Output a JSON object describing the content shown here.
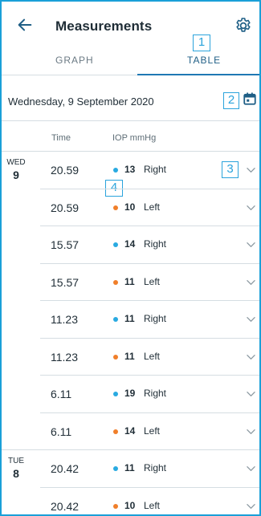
{
  "header": {
    "title": "Measurements"
  },
  "tabs": [
    {
      "label": "GRAPH",
      "active": false
    },
    {
      "label": "TABLE",
      "active": true
    }
  ],
  "callouts": [
    "1",
    "2",
    "3",
    "4"
  ],
  "date_selector": {
    "label": "Wednesday, 9 September 2020"
  },
  "columns": {
    "time": "Time",
    "iop": "IOP mmHg"
  },
  "colors": {
    "right_eye": "#29aae1",
    "left_eye": "#f07f2a",
    "accent": "#1f78b4"
  },
  "rows": [
    {
      "day_name": "WED",
      "day_num": "9",
      "time": "20.59",
      "value": "13",
      "eye": "Right",
      "eye_key": "right_eye"
    },
    {
      "day_name": "",
      "day_num": "",
      "time": "20.59",
      "value": "10",
      "eye": "Left",
      "eye_key": "left_eye"
    },
    {
      "day_name": "",
      "day_num": "",
      "time": "15.57",
      "value": "14",
      "eye": "Right",
      "eye_key": "right_eye"
    },
    {
      "day_name": "",
      "day_num": "",
      "time": "15.57",
      "value": "11",
      "eye": "Left",
      "eye_key": "left_eye"
    },
    {
      "day_name": "",
      "day_num": "",
      "time": "11.23",
      "value": "11",
      "eye": "Right",
      "eye_key": "right_eye"
    },
    {
      "day_name": "",
      "day_num": "",
      "time": "11.23",
      "value": "11",
      "eye": "Left",
      "eye_key": "left_eye"
    },
    {
      "day_name": "",
      "day_num": "",
      "time": "6.11",
      "value": "19",
      "eye": "Right",
      "eye_key": "right_eye"
    },
    {
      "day_name": "",
      "day_num": "",
      "time": "6.11",
      "value": "14",
      "eye": "Left",
      "eye_key": "left_eye"
    },
    {
      "day_name": "TUE",
      "day_num": "8",
      "time": "20.42",
      "value": "11",
      "eye": "Right",
      "eye_key": "right_eye"
    },
    {
      "day_name": "",
      "day_num": "",
      "time": "20.42",
      "value": "10",
      "eye": "Left",
      "eye_key": "left_eye"
    }
  ]
}
